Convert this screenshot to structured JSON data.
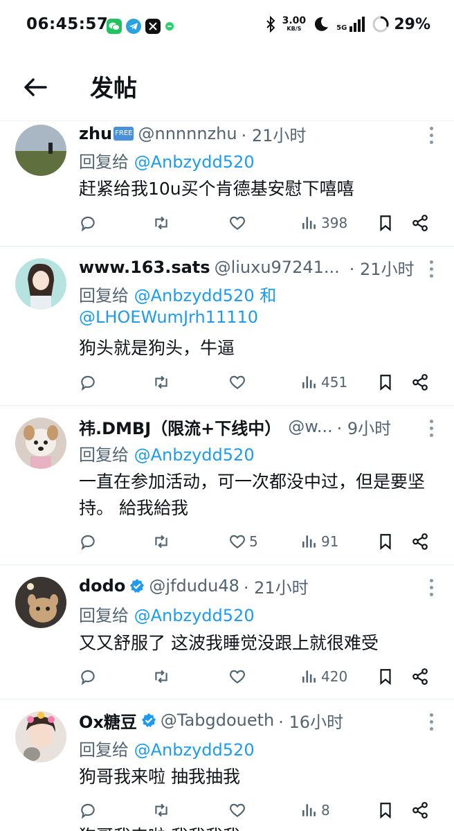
{
  "status_bar": {
    "time": "06:45:57",
    "speed_value": "3.00",
    "speed_unit": "KB/S",
    "network": "5G",
    "battery": "29%"
  },
  "header": {
    "title": "发帖"
  },
  "tweets": [
    {
      "username": "zhu",
      "badge": "FREE",
      "handle": "@nnnnnzhu",
      "time": "· 21小时",
      "reply_prefix": "回复给 ",
      "reply_to": "@Anbzydd520",
      "reply_to2": "",
      "text": "赶紧给我10u买个肯德基安慰下嘻嘻",
      "likes": "",
      "views": "398"
    },
    {
      "username": "www.163.sats",
      "handle": "@liuxu97241...",
      "time": "· 21小时",
      "reply_prefix": "回复给 ",
      "reply_to": "@Anbzydd520 和",
      "reply_to2": "@LHOEWumJrh11110",
      "text": "狗头就是狗头，牛逼",
      "likes": "",
      "views": "451"
    },
    {
      "username": "祎.DMBJ（限流+下线中）",
      "handle": "@w...",
      "time": "· 9小时",
      "reply_prefix": "回复给 ",
      "reply_to": "@Anbzydd520",
      "reply_to2": "",
      "text": "一直在参加活动，可一次都没中过，但是要坚持。 給我給我",
      "likes": "5",
      "views": "91"
    },
    {
      "username": "dodo",
      "handle": "@jfdudu48",
      "time": "· 21小时",
      "reply_prefix": "回复给 ",
      "reply_to": "@Anbzydd520",
      "reply_to2": "",
      "text": "又又舒服了 这波我睡觉没跟上就很难受",
      "likes": "",
      "views": "420"
    },
    {
      "username": "Ox糖豆",
      "handle": "@Tabgdoueth",
      "time": "· 16小时",
      "reply_prefix": "回复给 ",
      "reply_to": "@Anbzydd520",
      "reply_to2": "",
      "text": "狗哥我来啦 抽我抽我",
      "likes": "",
      "views": "8"
    }
  ],
  "next_tweet_partial": "狗哥我来啦 我我我我",
  "colors": {
    "link": "#1d9bf0",
    "verified": "#1d9bf0",
    "muted": "#536471"
  }
}
